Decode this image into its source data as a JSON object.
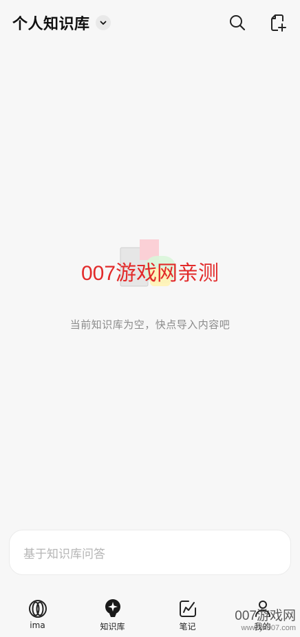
{
  "header": {
    "title": "个人知识库"
  },
  "icons": {
    "dropdown": "chevron-down-icon",
    "search": "search-icon",
    "new_doc": "new-document-icon"
  },
  "empty_state": {
    "message": "当前知识库为空，快点导入内容吧"
  },
  "watermark": {
    "center_text": "007游戏网亲测",
    "corner_text": "007游戏网",
    "corner_url": "www.yx007.com"
  },
  "ask_input": {
    "placeholder": "基于知识库问答"
  },
  "bottom_nav": {
    "items": [
      {
        "label": "ima",
        "icon": "ima-logo-icon"
      },
      {
        "label": "知识库",
        "icon": "knowledge-bulb-icon",
        "active": true
      },
      {
        "label": "笔记",
        "icon": "note-edit-icon"
      },
      {
        "label": "我的",
        "icon": "profile-icon"
      }
    ]
  },
  "colors": {
    "background": "#f7f7f7",
    "watermark_red": "#e22a2a",
    "muted_text": "#8a8a8a"
  }
}
